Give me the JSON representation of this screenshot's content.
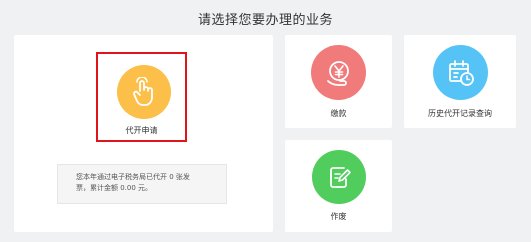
{
  "heading": "请选择您要办理的业务",
  "services": {
    "apply": {
      "label": "代开申请",
      "icon": "hand-pointer-icon",
      "color": "#fbbf4a"
    },
    "pay": {
      "label": "缴款",
      "icon": "yuan-coin-icon",
      "color": "#f17a7a"
    },
    "history": {
      "label": "历史代开记录查询",
      "icon": "calendar-clock-icon",
      "color": "#55c3f5"
    },
    "void": {
      "label": "作废",
      "icon": "edit-document-icon",
      "color": "#50cd5c"
    }
  },
  "notice": {
    "line1": "您本年通过电子税务局已代开 0 张发",
    "line2": "票，累计金额 0.00 元。"
  },
  "colors": {
    "highlight_border": "#e0141a",
    "background": "#f0f1f3"
  }
}
